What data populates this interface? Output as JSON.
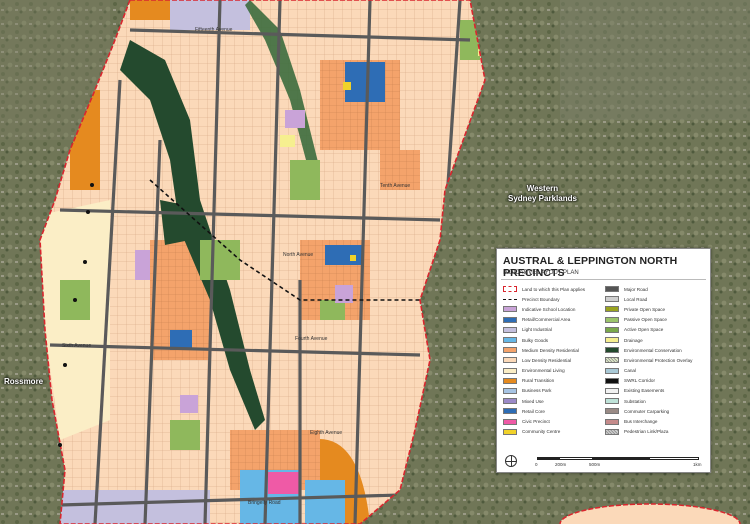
{
  "labels": {
    "western_sydney_parklands": "Western\nSydney Parklands",
    "rossmore": "Rossmore"
  },
  "streets": {
    "fifteenth_avenue": "Fifteenth Avenue",
    "tenth_avenue": "Tenth Avenue",
    "north_avenue": "North Avenue",
    "fourth_avenue": "Fourth Avenue",
    "sixth_avenue": "Sixth Avenue",
    "edmondson_avenue": "Edmondson Avenue",
    "bringelly_road": "Bringelly Road",
    "eighth_avenue": "Eighth Avenue"
  },
  "legend": {
    "title": "AUSTRAL & LEPPINGTON NORTH PRECINCTS",
    "subtitle": "INDICATIVE LAYOUT PLAN",
    "left_items": [
      {
        "label": "Land to which this Plan applies",
        "color": "#ffffff",
        "swatch": "boundary-red"
      },
      {
        "label": "Precinct Boundary",
        "color": "#ffffff",
        "swatch": "boundary-dash"
      },
      {
        "label": "Indicative School Location",
        "color": "#c9a3d8",
        "swatch": "fill"
      },
      {
        "label": "Retail/Commercial Area",
        "color": "#2e6db5",
        "swatch": "fill"
      },
      {
        "label": "Light Industrial",
        "color": "#c4c0de",
        "swatch": "fill"
      },
      {
        "label": "Bulky Goods",
        "color": "#66b7e6",
        "swatch": "fill"
      },
      {
        "label": "Medium Density Residential",
        "color": "#f4a36b",
        "swatch": "fill"
      },
      {
        "label": "Low Density Residential",
        "color": "#fbd9b9",
        "swatch": "fill"
      },
      {
        "label": "Environmental Living",
        "color": "#fbeec6",
        "swatch": "fill"
      },
      {
        "label": "Rural Transition",
        "color": "#e58a1f",
        "swatch": "fill"
      },
      {
        "label": "Business Park",
        "color": "#a7c4e4",
        "swatch": "fill"
      },
      {
        "label": "Mixed Use",
        "color": "#9b8ac8",
        "swatch": "fill"
      },
      {
        "label": "Retail Core",
        "color": "#2e6db5",
        "swatch": "fill"
      },
      {
        "label": "Civic Precinct",
        "color": "#ef5aa6",
        "swatch": "fill"
      },
      {
        "label": "Community Centre",
        "color": "#f1d22a",
        "swatch": "fill"
      }
    ],
    "right_items": [
      {
        "label": "Major Road",
        "color": "#555555",
        "swatch": "fill"
      },
      {
        "label": "Local Road",
        "color": "#cfcfcf",
        "swatch": "fill"
      },
      {
        "label": "Private Open Space",
        "color": "#9aa31f",
        "swatch": "fill"
      },
      {
        "label": "Passive Open Space",
        "color": "#9bc46b",
        "swatch": "fill"
      },
      {
        "label": "Active Open Space",
        "color": "#7aa84b",
        "swatch": "fill"
      },
      {
        "label": "Drainage",
        "color": "#f6ef8f",
        "swatch": "fill"
      },
      {
        "label": "Environmental Conservation",
        "color": "#244a2e",
        "swatch": "fill"
      },
      {
        "label": "Environmental Protection Overlay",
        "color": "#dfe9c8",
        "swatch": "hatch"
      },
      {
        "label": "Canal",
        "color": "#a9c9d6",
        "swatch": "fill"
      },
      {
        "label": "SWRL Corridor",
        "color": "#111111",
        "swatch": "fill"
      },
      {
        "label": "Existing Easements",
        "color": "#f2f2f2",
        "swatch": "fill"
      },
      {
        "label": "Substation",
        "color": "#bfe3d9",
        "swatch": "fill"
      },
      {
        "label": "Commuter Carparking",
        "color": "#9a8b86",
        "swatch": "fill"
      },
      {
        "label": "Bus Interchange",
        "color": "#c58b8b",
        "swatch": "fill"
      },
      {
        "label": "Pedestrian Link/Plaza",
        "color": "#cccccc",
        "swatch": "hatch"
      }
    ],
    "scale": {
      "ticks": [
        "0",
        "200m",
        "500m",
        "1km"
      ]
    }
  },
  "colors": {
    "aerial": "#6f7556",
    "low_density": "#fbd9b9",
    "medium_density": "#f4a36b",
    "env_living": "#fbeec6",
    "env_conservation": "#244a2e",
    "open_space": "#8fb85c",
    "major_road": "#5a5a5a",
    "local_road": "#cfcfcf",
    "boundary": "#d9262e",
    "retail": "#2e6db5",
    "rural": "#e58a1f",
    "school": "#c9a3d8",
    "bulky": "#66b7e6",
    "civic": "#ef5aa6",
    "light_industrial": "#c4c0de"
  }
}
